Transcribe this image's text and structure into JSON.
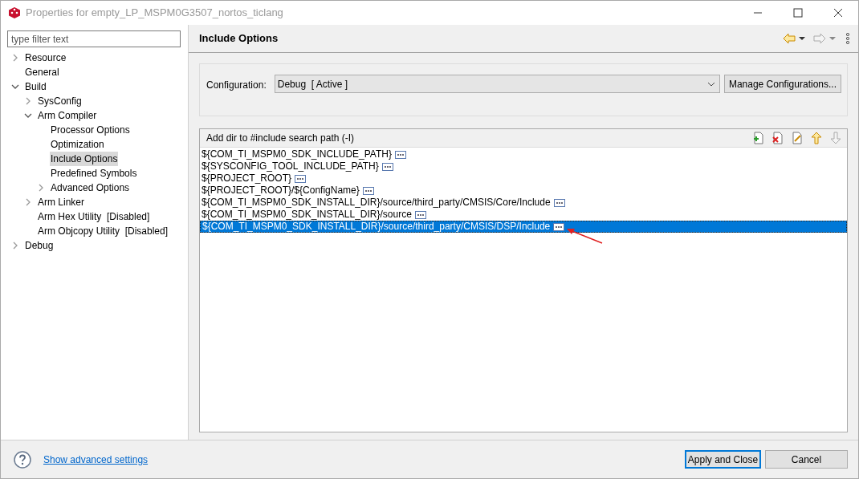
{
  "window": {
    "title": "Properties for empty_LP_MSPM0G3507_nortos_ticlang"
  },
  "filter": {
    "placeholder": "type filter text"
  },
  "tree": [
    {
      "label": "Resource",
      "expanded": false,
      "selected": false
    },
    {
      "label": "General",
      "selected": false
    },
    {
      "label": "Build",
      "expanded": true,
      "selected": false,
      "children": [
        {
          "label": "SysConfig",
          "expanded": false,
          "selected": false
        },
        {
          "label": "Arm Compiler",
          "expanded": true,
          "selected": false,
          "children": [
            {
              "label": "Processor Options",
              "selected": false
            },
            {
              "label": "Optimization",
              "selected": false
            },
            {
              "label": "Include Options",
              "selected": true
            },
            {
              "label": "Predefined Symbols",
              "selected": false
            },
            {
              "label": "Advanced Options",
              "expanded": false,
              "selected": false
            }
          ]
        },
        {
          "label": "Arm Linker",
          "expanded": false,
          "selected": false
        },
        {
          "label": "Arm Hex Utility  [Disabled]",
          "selected": false
        },
        {
          "label": "Arm Objcopy Utility  [Disabled]",
          "selected": false
        }
      ]
    },
    {
      "label": "Debug",
      "expanded": false,
      "selected": false
    }
  ],
  "page": {
    "title": "Include Options"
  },
  "configuration": {
    "label": "Configuration:",
    "value": "Debug  [ Active ]",
    "manage_button": "Manage Configurations..."
  },
  "include_list": {
    "title": "Add dir to #include search path (-I)",
    "rows": [
      {
        "path": "${COM_TI_MSPM0_SDK_INCLUDE_PATH}",
        "selected": false
      },
      {
        "path": "${SYSCONFIG_TOOL_INCLUDE_PATH}",
        "selected": false
      },
      {
        "path": "${PROJECT_ROOT}",
        "selected": false
      },
      {
        "path": "${PROJECT_ROOT}/${ConfigName}",
        "selected": false
      },
      {
        "path": "${COM_TI_MSPM0_SDK_INSTALL_DIR}/source/third_party/CMSIS/Core/Include",
        "selected": false
      },
      {
        "path": "${COM_TI_MSPM0_SDK_INSTALL_DIR}/source",
        "selected": false
      },
      {
        "path": "${COM_TI_MSPM0_SDK_INSTALL_DIR}/source/third_party/CMSIS/DSP/Include",
        "selected": true
      }
    ]
  },
  "footer": {
    "link": "Show advanced settings",
    "buttons": [
      "Apply and Close",
      "Cancel"
    ]
  }
}
